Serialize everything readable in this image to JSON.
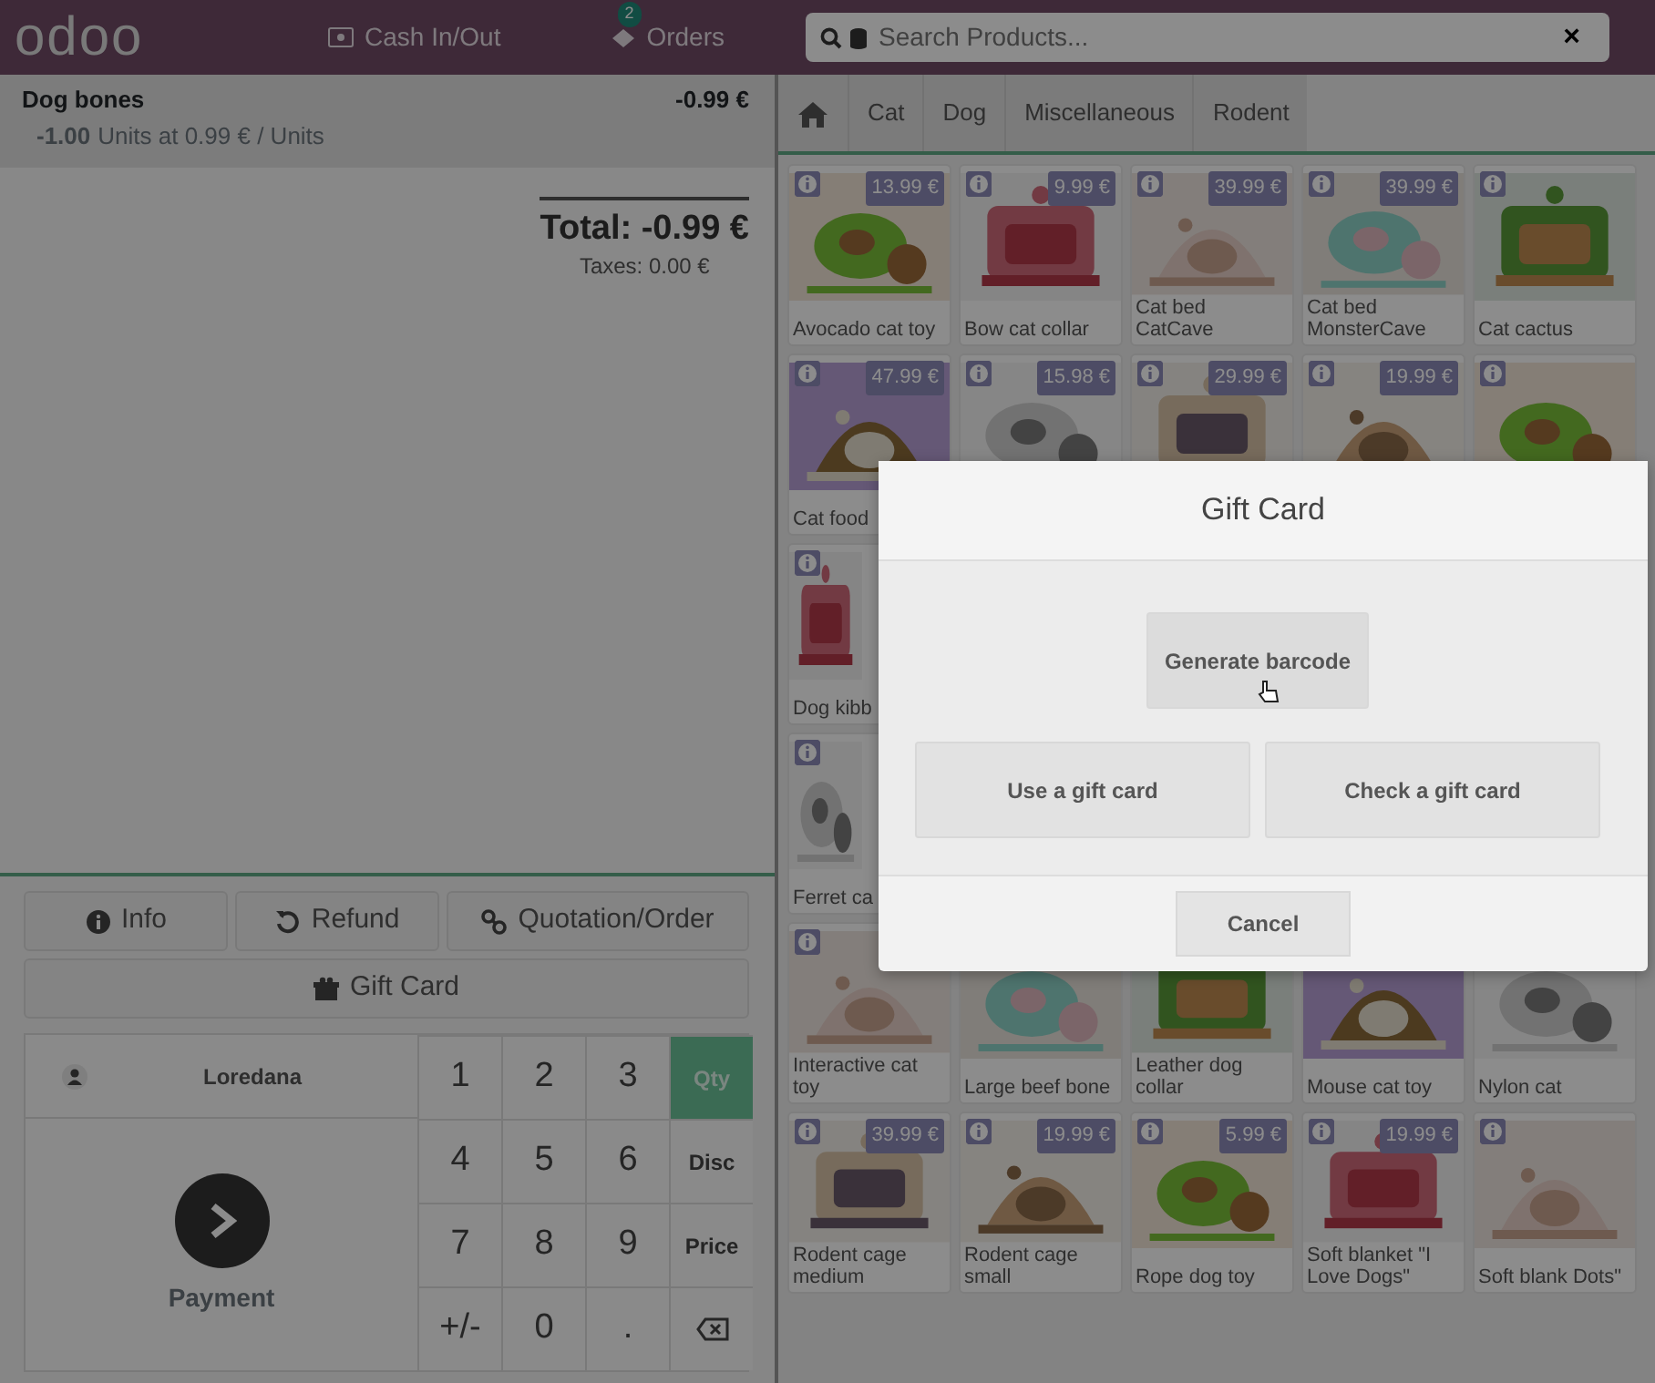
{
  "header": {
    "logo": "odoo",
    "cash_button": "Cash In/Out",
    "orders_button": "Orders",
    "orders_badge": "2",
    "search": {
      "placeholder": "Search Products..."
    },
    "clear_button": "×"
  },
  "order": {
    "lines": [
      {
        "product": "Dog bones",
        "price": "-0.99 €",
        "quantity": "-1.00",
        "unit_text": "Units at 0.99 € / Units",
        "selected": true
      }
    ],
    "total": "Total: -0.99 €",
    "taxes": "Taxes: 0.00 €"
  },
  "actions": [
    {
      "label": "Info"
    },
    {
      "label": "Refund"
    },
    {
      "label": "Quotation/Order"
    },
    {
      "label": "Gift Card"
    }
  ],
  "customer": "Loredana",
  "payment": "Payment",
  "numpad": [
    {
      "kind": "digit",
      "label": "1"
    },
    {
      "kind": "digit",
      "label": "2"
    },
    {
      "kind": "digit",
      "label": "3"
    },
    {
      "kind": "mode",
      "label": "Qty",
      "selected": true
    },
    {
      "kind": "digit",
      "label": "4"
    },
    {
      "kind": "digit",
      "label": "5"
    },
    {
      "kind": "digit",
      "label": "6"
    },
    {
      "kind": "mode",
      "label": "Disc",
      "selected": false
    },
    {
      "kind": "digit",
      "label": "7"
    },
    {
      "kind": "digit",
      "label": "8"
    },
    {
      "kind": "digit",
      "label": "9"
    },
    {
      "kind": "mode",
      "label": "Price",
      "selected": false
    },
    {
      "kind": "digit",
      "label": "+/-"
    },
    {
      "kind": "digit",
      "label": "0"
    },
    {
      "kind": "digit",
      "label": "."
    },
    {
      "kind": "backspace"
    }
  ],
  "categories": [
    {
      "label": "Cat"
    },
    {
      "label": "Dog"
    },
    {
      "label": "Miscellaneous"
    },
    {
      "label": "Rodent"
    }
  ],
  "product_rows": [
    [
      {
        "name": "Avocado cat toy",
        "price": "13.99 €",
        "info": true
      },
      {
        "name": "Bow cat collar",
        "price": "9.99 €",
        "info": true
      },
      {
        "name": "Cat bed CatCave",
        "price": "39.99 €",
        "info": true
      },
      {
        "name": "Cat bed MonsterCave",
        "price": "39.99 €",
        "info": true
      },
      {
        "name": "Cat cactus",
        "info": true
      }
    ],
    [
      {
        "name": "Cat food",
        "price": "47.99 €",
        "info": true
      },
      {
        "price": "15.98 €",
        "info": true
      },
      {
        "price": "29.99 €",
        "info": true
      },
      {
        "price": "19.99 €",
        "info": true
      },
      {
        "info": true
      }
    ],
    [
      {
        "name": "Dog kibb",
        "info": true
      }
    ],
    [
      {
        "name": "Ferret ca",
        "info": true
      }
    ],
    [
      {
        "name": "Interactive cat toy",
        "info": true
      },
      {
        "name": "Large beef bone"
      },
      {
        "name": "Leather dog collar"
      },
      {
        "name": "Mouse cat toy"
      },
      {
        "name": "Nylon cat"
      }
    ],
    [
      {
        "name": "Rodent cage medium",
        "price": "39.99 €",
        "info": true
      },
      {
        "name": "Rodent cage small",
        "price": "19.99 €",
        "info": true
      },
      {
        "name": "Rope dog toy",
        "price": "5.99 €",
        "info": true
      },
      {
        "name": "Soft blanket \"I Love Dogs\"",
        "price": "19.99 €",
        "info": true
      },
      {
        "name": "Soft blank Dots\"",
        "info": true
      }
    ]
  ],
  "dialog": {
    "title": "Gift Card",
    "buttons": [
      {
        "label": "Generate barcode",
        "hovered": true
      },
      {
        "label": "Use a gift card",
        "hovered": false
      },
      {
        "label": "Check a gift card",
        "hovered": false
      }
    ],
    "cancel": "Cancel"
  }
}
